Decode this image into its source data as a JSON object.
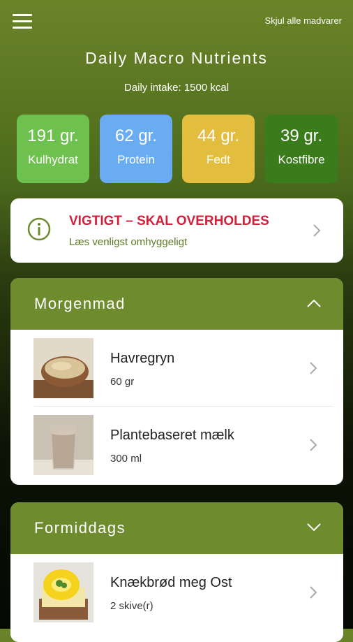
{
  "header": {
    "hide_all_label": "Skjul alle madvarer",
    "title": "Daily Macro Nutrients",
    "intake": "Daily intake: 1500 kcal"
  },
  "macros": [
    {
      "value": "191 gr.",
      "label": "Kulhydrat",
      "color": "#6fc14f"
    },
    {
      "value": "62 gr.",
      "label": "Protein",
      "color": "#6aacf2"
    },
    {
      "value": "44 gr.",
      "label": "Fedt",
      "color": "#e3bd3e"
    },
    {
      "value": "39 gr.",
      "label": "Kostfibre",
      "color": "#3a7b1c"
    }
  ],
  "notice": {
    "title": "VIGTIGT – SKAL OVERHOLDES",
    "subtitle": "Læs venligst omhyggeligt",
    "icon": "info-icon"
  },
  "sections": [
    {
      "title": "Morgenmad",
      "expanded": true,
      "items": [
        {
          "name": "Havregryn",
          "amount": "60 gr",
          "icon": "oats-bowl-image"
        },
        {
          "name": "Plantebaseret mælk",
          "amount": "300 ml",
          "icon": "milk-glass-image"
        }
      ]
    },
    {
      "title": "Formiddags",
      "expanded": false,
      "items": [
        {
          "name": "Knækbrød meg Ost",
          "amount": "2 skive(r)",
          "icon": "crispbread-cheese-image"
        }
      ]
    }
  ],
  "colors": {
    "section_header": "#6e8b2e",
    "notice_title": "#d0213a",
    "notice_subtitle": "#5a7a25"
  }
}
